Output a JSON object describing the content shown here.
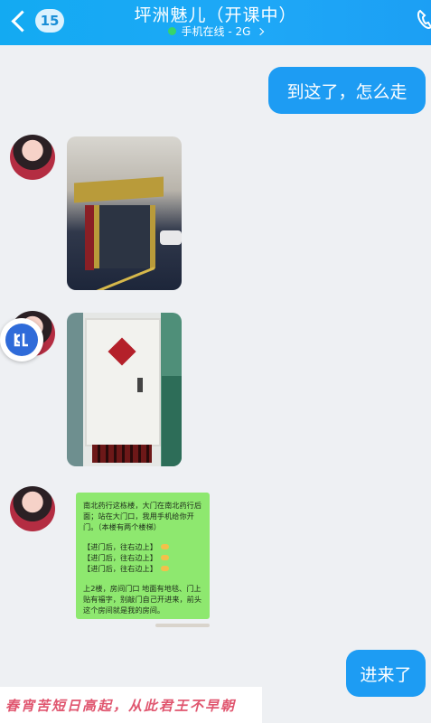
{
  "header": {
    "unread_count": "15",
    "title": "坪洲魅儿（开课中）",
    "status": "手机在线 - 2G"
  },
  "messages": {
    "m1": "到这了，怎么走",
    "note": {
      "lines": [
        "南北药行这栋楼，大门在南北药行后面；站在大门口，我用手机给你开门。（本楼有两个楼梯）",
        "【进门后，往右边上】",
        "【进门后，往右边上】",
        "【进门后，往右边上】",
        "上2楼，房间门口 地面有地毯、门上贴有福字，别敲门自己开进来，前头这个房间就是我的房间。"
      ]
    },
    "m2": "进来了"
  },
  "banner": {
    "text": "春宵苦短日高起，从此君王不早朝"
  },
  "colors": {
    "header": "#1ea8f7",
    "bubble_right": "#1d9cf3",
    "note_bg": "#8ee86f",
    "background": "#eef0f3"
  }
}
